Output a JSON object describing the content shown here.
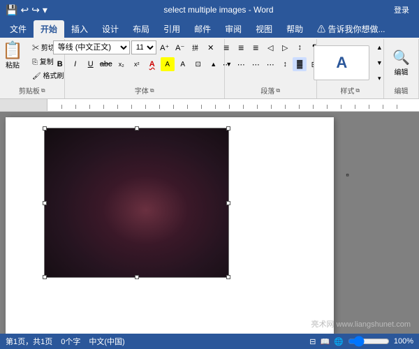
{
  "titlebar": {
    "title": "select multiple images  -  Word",
    "login_label": "登录",
    "save_icon": "💾",
    "undo_icon": "↩",
    "redo_icon": "↪",
    "customize_icon": "▾"
  },
  "tabs": [
    {
      "label": "文件",
      "active": false
    },
    {
      "label": "开始",
      "active": true
    },
    {
      "label": "插入",
      "active": false
    },
    {
      "label": "设计",
      "active": false
    },
    {
      "label": "布局",
      "active": false
    },
    {
      "label": "引用",
      "active": false
    },
    {
      "label": "邮件",
      "active": false
    },
    {
      "label": "审阅",
      "active": false
    },
    {
      "label": "视图",
      "active": false
    },
    {
      "label": "帮助",
      "active": false
    },
    {
      "label": "⚠ 告诉我你想做...",
      "active": false
    }
  ],
  "ribbon": {
    "clipboard": {
      "label": "剪贴板",
      "paste": "粘贴",
      "cut": "剪切",
      "copy": "复制",
      "format_painter": "格式刷"
    },
    "font": {
      "label": "字体",
      "font_name": "等线 (中文正文)",
      "font_size": "11",
      "bold": "B",
      "italic": "I",
      "underline": "U",
      "strikethrough": "abc",
      "superscript": "x²",
      "subscript": "x₂",
      "clear_format": "✕",
      "font_color": "A",
      "highlight": "A",
      "size_up": "▲",
      "size_down": "▼",
      "char_shading": "A",
      "char_border": "⊡"
    },
    "paragraph": {
      "label": "段落",
      "bullets": "≡",
      "numbering": "≡",
      "outline": "≡",
      "decrease_indent": "◁",
      "increase_indent": "▷",
      "sort": "↕",
      "show_marks": "¶",
      "align_left": "≡",
      "align_center": "≡",
      "align_right": "≡",
      "justify": "≡",
      "line_spacing": "≡",
      "shading": "▓",
      "borders": "⊞"
    },
    "styles": {
      "label": "样式",
      "style_name": "A"
    },
    "editing": {
      "label": "编辑",
      "icon": "🔍"
    }
  },
  "statusbar": {
    "page_info": "第1页，共1页",
    "word_count": "0个字",
    "language": "中文(中国)",
    "watermark": "亮术网 www.liangshunet.com"
  }
}
